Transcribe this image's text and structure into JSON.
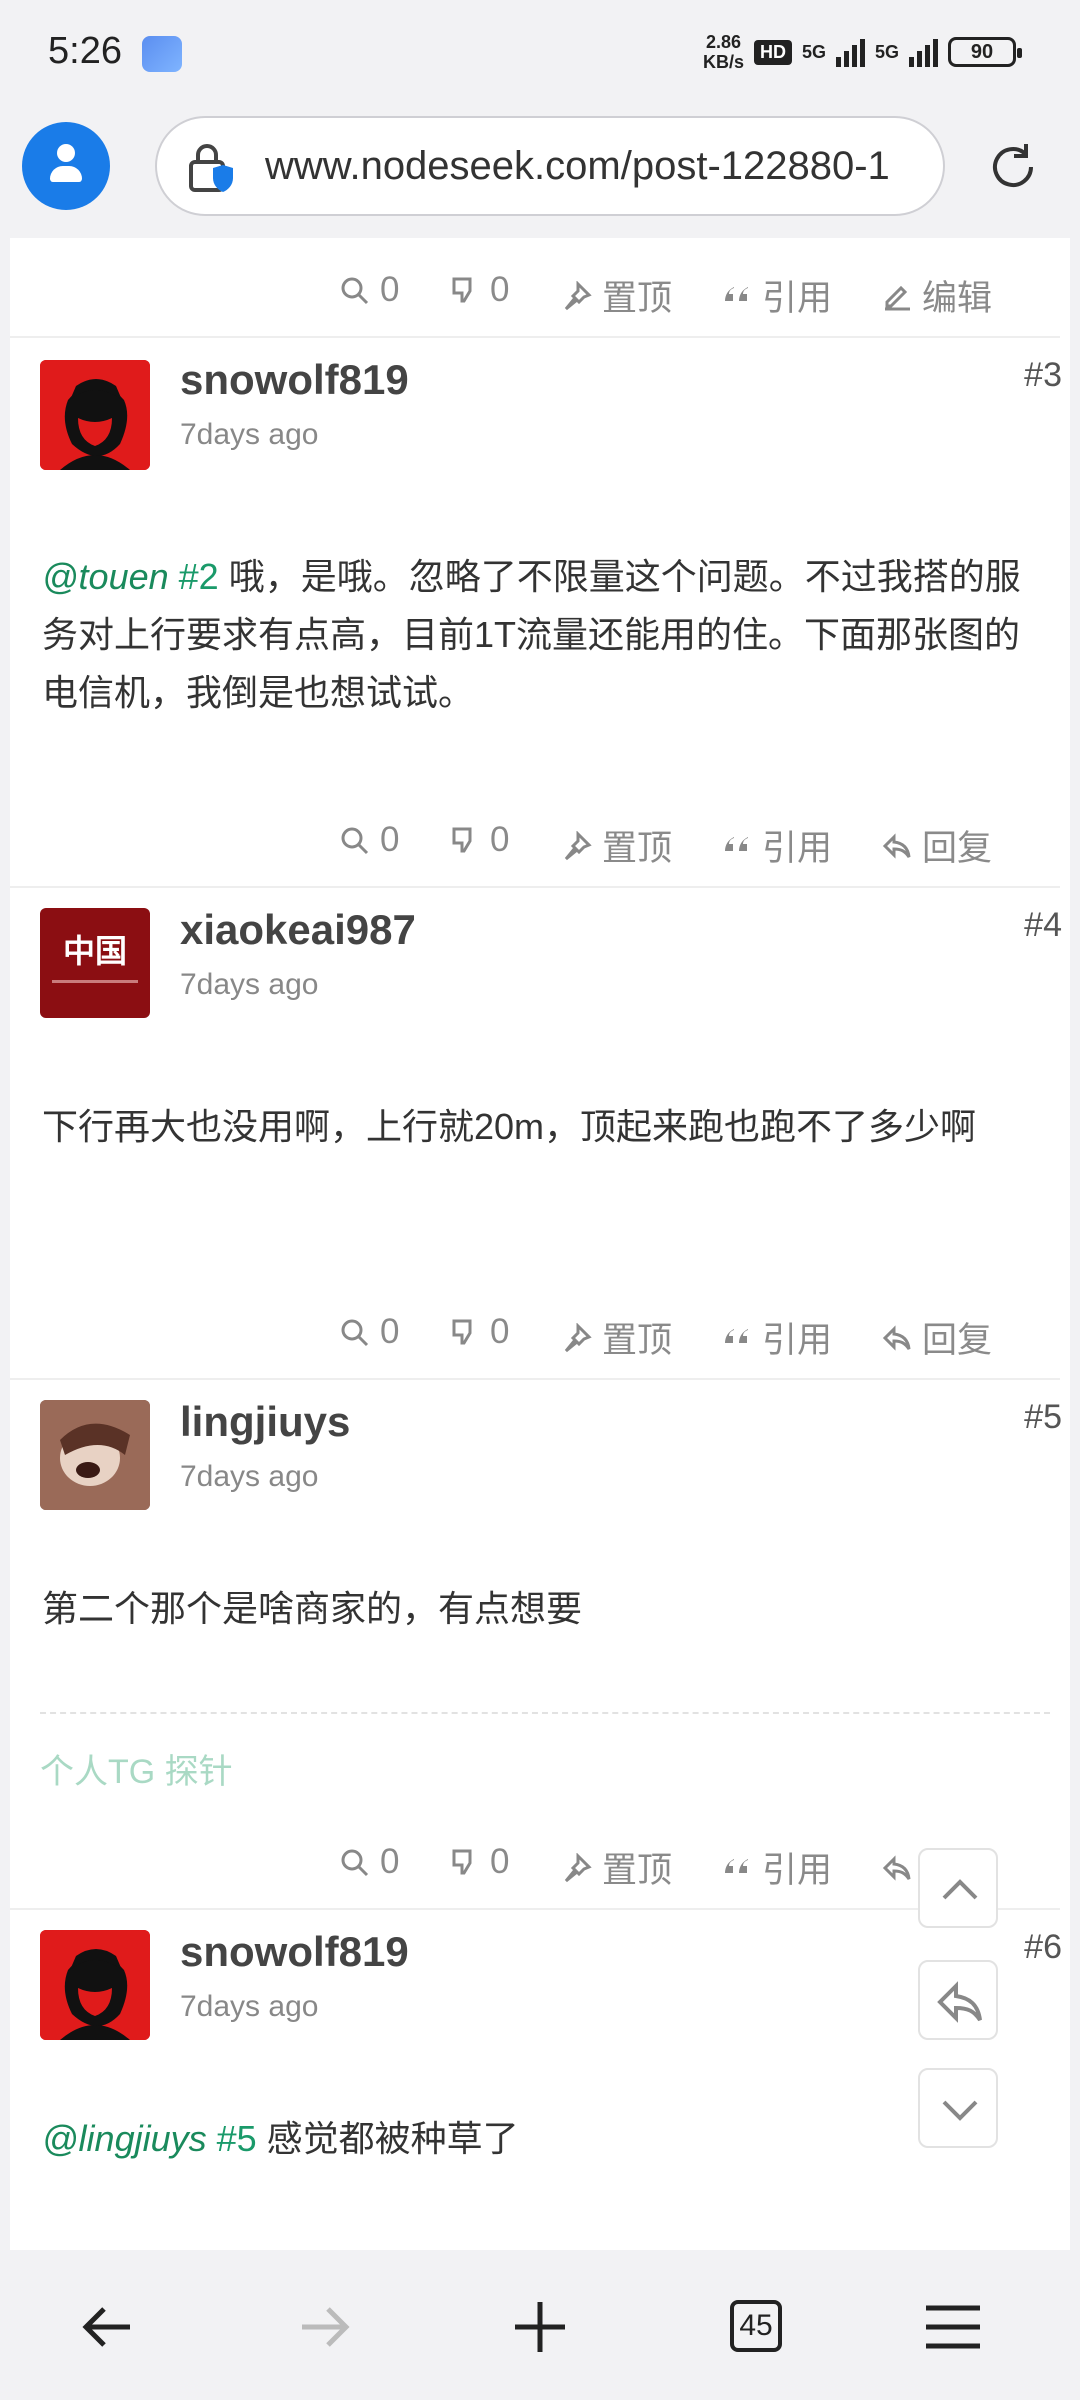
{
  "status_bar": {
    "time": "5:26",
    "speed_value": "2.86",
    "speed_unit": "KB/s",
    "hd_label": "HD",
    "net1": "5G",
    "net2": "5G",
    "battery": "90"
  },
  "browser": {
    "url": "www.nodeseek.com/post-122880-1",
    "tab_count": "45"
  },
  "top_actions": {
    "views": "0",
    "dislikes": "0",
    "pin_label": "置顶",
    "quote_label": "引用",
    "edit_label": "编辑"
  },
  "posts": [
    {
      "username": "snowolf819",
      "time": "7days ago",
      "floor": "#3",
      "mention": "@touen",
      "mention_floor": "#2",
      "body": " 哦，是哦。忽略了不限量这个问题。不过我搭的服务对上行要求有点高，目前1T流量还能用的住。下面那张图的电信机，我倒是也想试试。",
      "views": "0",
      "dislikes": "0",
      "pin_label": "置顶",
      "quote_label": "引用",
      "reply_label": "回复"
    },
    {
      "username": "xiaokeai987",
      "time": "7days ago",
      "floor": "#4",
      "avatar_text": "中国",
      "body": "下行再大也没用啊，上行就20m，顶起来跑也跑不了多少啊",
      "views": "0",
      "dislikes": "0",
      "pin_label": "置顶",
      "quote_label": "引用",
      "reply_label": "回复"
    },
    {
      "username": "lingjiuys",
      "time": "7days ago",
      "floor": "#5",
      "body": "第二个那个是啥商家的，有点想要",
      "signature": "个人TG 探针",
      "views": "0",
      "dislikes": "0",
      "pin_label": "置顶",
      "quote_label": "引用",
      "reply_label": "回复"
    },
    {
      "username": "snowolf819",
      "time": "7days ago",
      "floor": "#6",
      "mention": "@lingjiuys",
      "mention_floor": "#5",
      "body": " 感觉都被种草了"
    }
  ],
  "colors": {
    "accent_green": "#1a9a6a",
    "avatar_blue": "#1a7ce8"
  }
}
